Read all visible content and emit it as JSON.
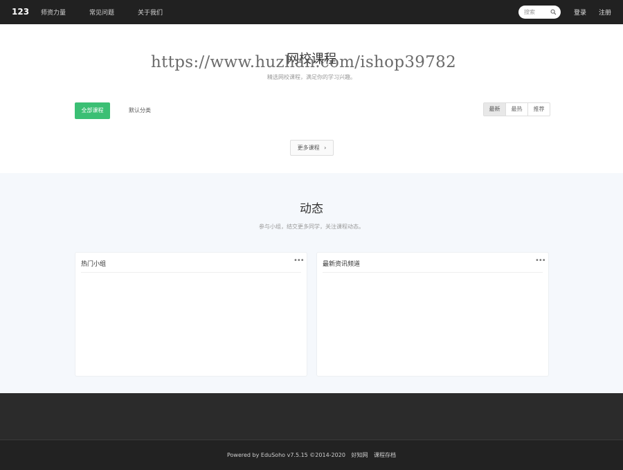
{
  "nav": {
    "brand": "123",
    "links": [
      "师资力量",
      "常见问题",
      "关于我们"
    ],
    "search_placeholder": "搜索",
    "login": "登录",
    "register": "注册"
  },
  "courses": {
    "title": "网校课程",
    "subtitle": "精选网校课程，满足你的学习兴趣。",
    "watermark": "https://www.huzhan.com/ishop39782",
    "categories": [
      "全部课程",
      "默认分类"
    ],
    "sort": [
      "最新",
      "最热",
      "推荐"
    ],
    "more_button": "更多课程",
    "more_arrow": "›"
  },
  "dynamics": {
    "title": "动态",
    "subtitle": "参与小组，结交更多同学，关注课程动态。",
    "panels": [
      {
        "title": "热门小组",
        "more": "•••"
      },
      {
        "title": "最新资讯频道",
        "more": "•••"
      }
    ]
  },
  "footer": {
    "powered": "Powered by EduSoho v7.5.15 ©2014-2020",
    "links": [
      "好知网",
      "课程存档"
    ]
  }
}
